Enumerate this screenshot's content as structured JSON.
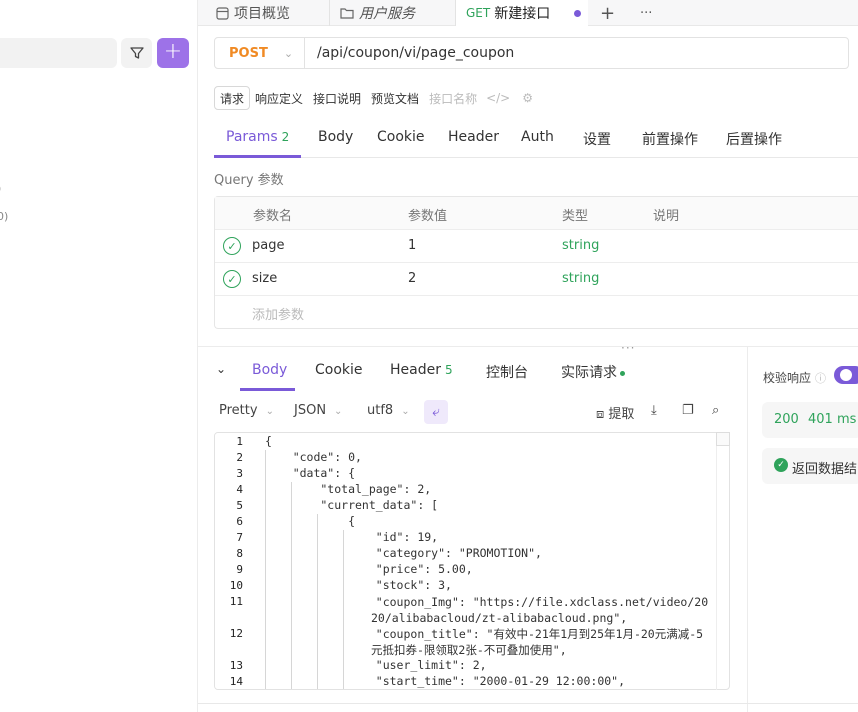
{
  "left_panel": {
    "fragments": [
      ")",
      "0)"
    ]
  },
  "tabs": [
    {
      "icon": "overview-icon",
      "label": "项目概览"
    },
    {
      "icon": "folder-icon",
      "label": "用户服务"
    },
    {
      "method": "GET",
      "label": "新建接口",
      "active": true
    }
  ],
  "tab_actions": {
    "add": "+",
    "more": "···"
  },
  "request": {
    "method": "POST",
    "url": "/api/coupon/vi/page_coupon"
  },
  "segments": [
    "请求",
    "响应定义",
    "接口说明",
    "预览文档"
  ],
  "name_placeholder": "接口名称",
  "param_tabs": [
    {
      "label": "Params",
      "count": "2",
      "active": true
    },
    {
      "label": "Body"
    },
    {
      "label": "Cookie"
    },
    {
      "label": "Header"
    },
    {
      "label": "Auth"
    },
    {
      "label": "设置"
    },
    {
      "label": "前置操作"
    },
    {
      "label": "后置操作"
    }
  ],
  "query_label": "Query 参数",
  "params_table": {
    "headers": [
      "参数名",
      "参数值",
      "类型",
      "说明"
    ],
    "rows": [
      {
        "name": "page",
        "value": "1",
        "type": "string",
        "desc": ""
      },
      {
        "name": "size",
        "value": "2",
        "type": "string",
        "desc": ""
      }
    ],
    "add_placeholder": "添加参数"
  },
  "response_tabs": [
    {
      "label": "Body",
      "active": true
    },
    {
      "label": "Cookie"
    },
    {
      "label": "Header",
      "count": "5"
    },
    {
      "label": "控制台"
    },
    {
      "label": "实际请求"
    }
  ],
  "format": {
    "view": "Pretty",
    "lang": "JSON",
    "encoding": "utf8",
    "extract": "提取"
  },
  "code_lines": [
    "{",
    "    \"code\": 0,",
    "    \"data\": {",
    "        \"total_page\": 2,",
    "        \"current_data\": [",
    "            {",
    "                \"id\": 19,",
    "                \"category\": \"PROMOTION\",",
    "                \"price\": 5.00,",
    "                \"stock\": 3,",
    "                \"coupon_Img\": \"https://file.xdclass.net/video/2020/alibabacloud/zt-alibabacloud.png\",",
    "                \"coupon_title\": \"有效中-21年1月到25年1月-20元满减-5元抵扣券-限领取2张-不可叠加使用\",",
    "                \"user_limit\": 2,",
    "                \"start_time\": \"2000-01-29 12:00:00\","
  ],
  "validation": {
    "label": "校验响应",
    "status": "200",
    "time": "401 ms",
    "result": "返回数据结"
  },
  "colors": {
    "accent": "#7a5ad8",
    "method_post": "#f08a24",
    "success": "#2fa35b"
  }
}
